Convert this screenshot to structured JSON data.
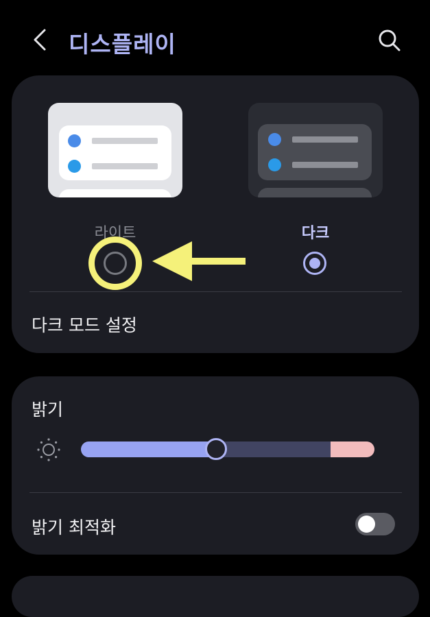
{
  "header": {
    "title": "디스플레이"
  },
  "theme": {
    "light_label": "라이트",
    "dark_label": "다크",
    "selected": "다크"
  },
  "dark_mode_settings_label": "다크 모드 설정",
  "brightness": {
    "label": "밝기",
    "level": 0.46
  },
  "adaptive_brightness": {
    "label": "밝기 최적화",
    "enabled": false
  },
  "colors": {
    "accent": "#aeb4f4",
    "card": "#1c1d24",
    "highlight": "#f5f17a"
  }
}
